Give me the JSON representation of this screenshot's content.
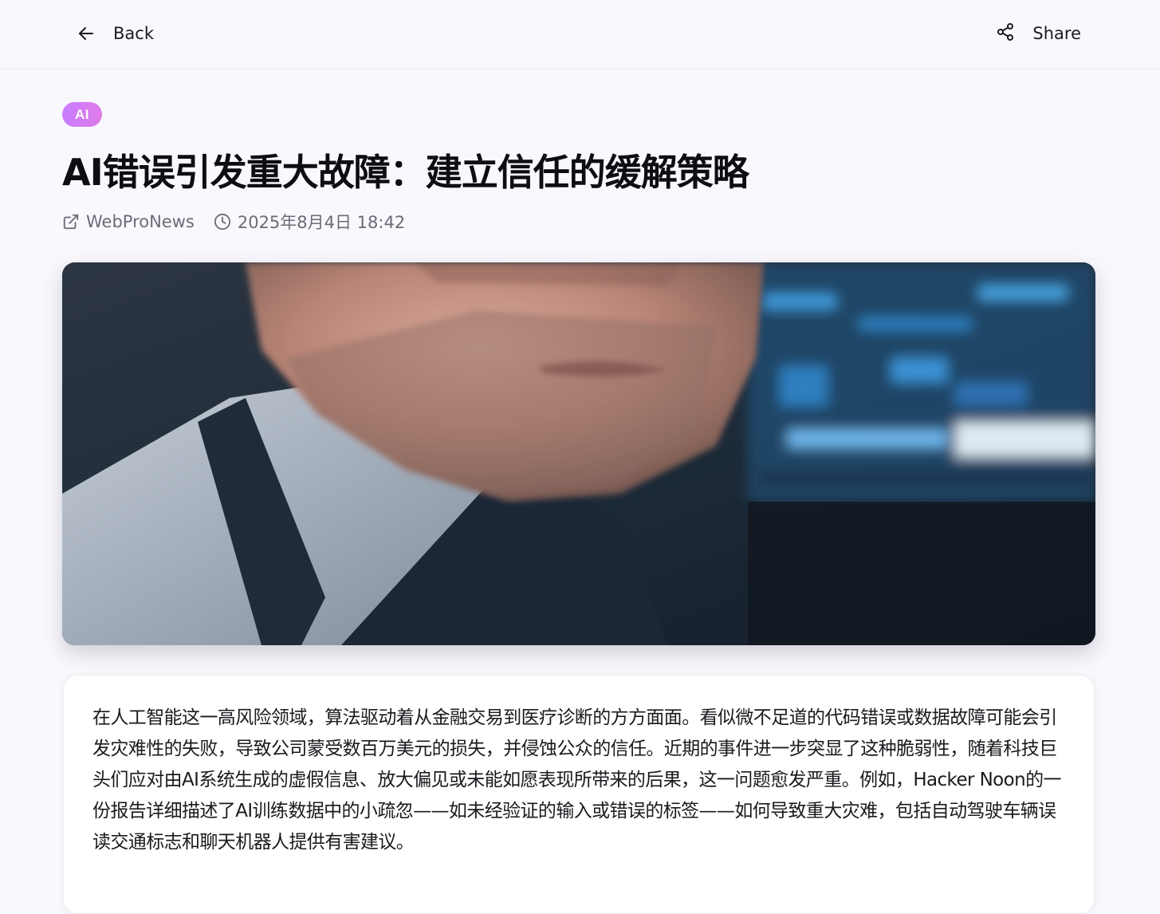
{
  "topbar": {
    "back_label": "Back",
    "share_label": "Share",
    "back_icon": "arrow-left-icon",
    "share_icon": "share-icon"
  },
  "article": {
    "category": "AI",
    "title": "AI错误引发重大故障：建立信任的缓解策略",
    "source": "WebProNews",
    "timestamp": "2025年8月4日 18:42",
    "source_icon": "external-link-icon",
    "time_icon": "clock-icon",
    "body": "在人工智能这一高风险领域，算法驱动着从金融交易到医疗诊断的方方面面。看似微不足道的代码错误或数据故障可能会引发灾难性的失败，导致公司蒙受数百万美元的损失，并侵蚀公众的信任。近期的事件进一步突显了这种脆弱性，随着科技巨头们应对由AI系统生成的虚假信息、放大偏见或未能如愿表现所带来的后果，这一问题愈发严重。例如，Hacker Noon的一份报告详细描述了AI训练数据中的小疏忽——如未经验证的输入或错误的标签——如何导致重大灾难，包括自动驾驶车辆误读交通标志和聊天机器人提供有害建议。"
  },
  "colors": {
    "tag_gradient_start": "#c77dff",
    "tag_gradient_end": "#e07ce8",
    "page_background": "#f9f8fd",
    "meta_text": "#6b6b78"
  }
}
